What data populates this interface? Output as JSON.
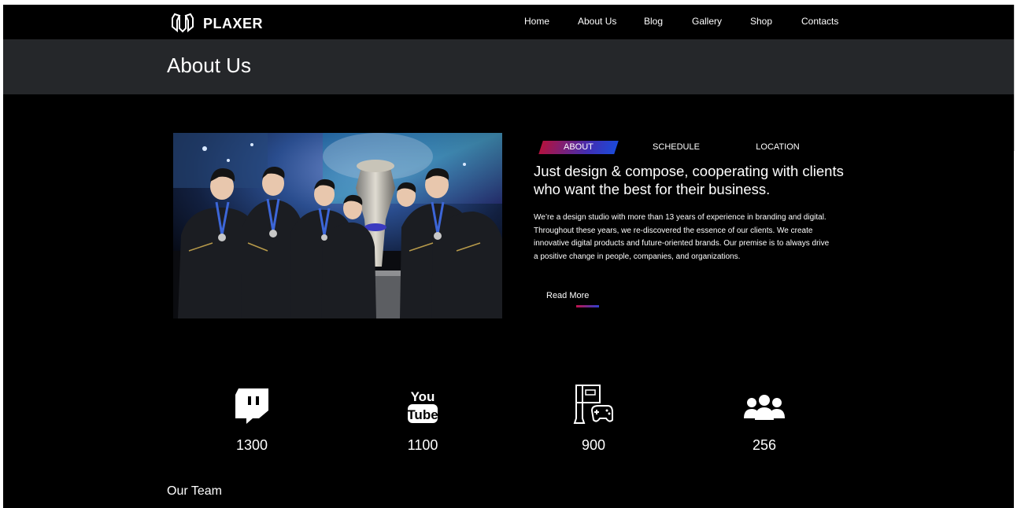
{
  "brand": {
    "name": "PLAXER"
  },
  "nav": {
    "items": [
      "Home",
      "About Us",
      "Blog",
      "Gallery",
      "Shop",
      "Contacts"
    ]
  },
  "page": {
    "title": "About Us"
  },
  "tabs": {
    "items": [
      "ABOUT",
      "SCHEDULE",
      "LOCATION"
    ],
    "active": "ABOUT"
  },
  "about": {
    "headline": "Just design & compose, cooperating with clients who want the best for their business.",
    "description": "We’re a design studio with more than 13 years of experience in branding and digital. Throughout these years, we re-discovered the essence of our clients. We create innovative digital products and future-oriented brands. Our premise is to always drive a positive change in people, companies, and organizations.",
    "read_more": "Read More"
  },
  "stats": [
    {
      "icon": "twitch-icon",
      "value": "1300"
    },
    {
      "icon": "youtube-icon",
      "value": "1100"
    },
    {
      "icon": "gaming-console-icon",
      "value": "900"
    },
    {
      "icon": "users-group-icon",
      "value": "256"
    }
  ],
  "team": {
    "title": "Our Team"
  },
  "colors": {
    "accent_start": "#c0134a",
    "accent_end": "#2d3fd0",
    "title_band": "#25272a",
    "background": "#000000"
  }
}
